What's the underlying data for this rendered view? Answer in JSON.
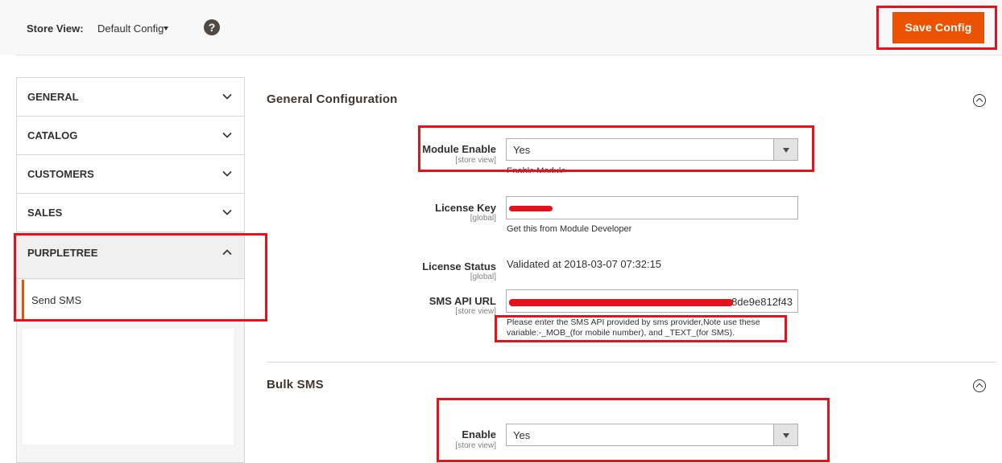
{
  "header": {
    "store_view_label": "Store View:",
    "store_view_value": "Default Config",
    "help_icon": "question-circle-icon",
    "save_button": "Save Config"
  },
  "sidebar": {
    "items": [
      {
        "label": "GENERAL",
        "icon": "chevron-down-icon"
      },
      {
        "label": "CATALOG",
        "icon": "chevron-down-icon"
      },
      {
        "label": "CUSTOMERS",
        "icon": "chevron-down-icon"
      },
      {
        "label": "SALES",
        "icon": "chevron-down-icon"
      },
      {
        "label": "PURPLETREE",
        "icon": "chevron-up-icon"
      }
    ],
    "sub_items": [
      {
        "label": "Send SMS"
      }
    ]
  },
  "sections": {
    "general": {
      "title": "General Configuration",
      "fields": {
        "module_enable": {
          "label": "Module Enable",
          "scope": "[store view]",
          "value": "Yes",
          "note": "Enable Module"
        },
        "license_key": {
          "label": "License Key",
          "scope": "[global]",
          "value": "",
          "note": "Get this from Module Developer"
        },
        "license_status": {
          "label": "License Status",
          "scope": "[global]",
          "value": "Validated at 2018-03-07 07:32:15"
        },
        "sms_api_url": {
          "label": "SMS API URL",
          "scope": "[store view]",
          "value": "8de9e812f43",
          "note_line1": "Please enter the SMS API provided by sms provider,Note use these",
          "note_line2": "variable:-_MOB_(for mobile number), and _TEXT_(for SMS)."
        }
      }
    },
    "bulk": {
      "title": "Bulk SMS",
      "fields": {
        "enable": {
          "label": "Enable",
          "scope": "[store view]",
          "value": "Yes"
        }
      }
    }
  },
  "colors": {
    "accent": "#eb5202",
    "highlight": "#e5121b"
  }
}
